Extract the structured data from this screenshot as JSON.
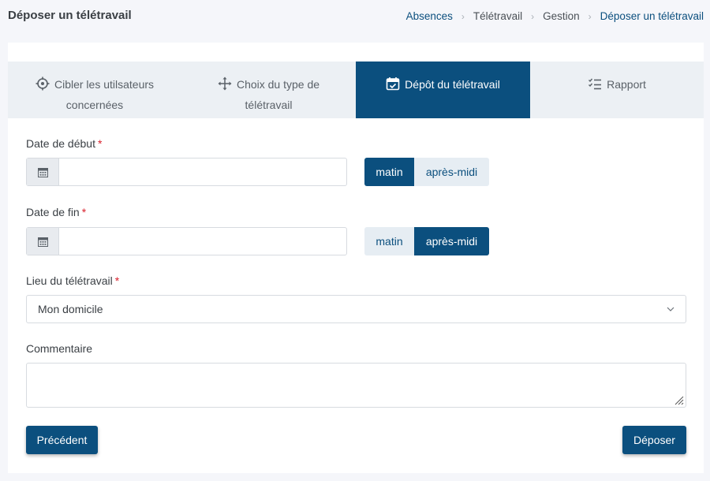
{
  "header": {
    "title": "Déposer un télétravail",
    "breadcrumb": [
      "Absences",
      "Télétravail",
      "Gestion",
      "Déposer un télétravail"
    ]
  },
  "tabs": [
    {
      "line1": "Cibler les utilsateurs",
      "line2": "concernées",
      "icon": "crosshair-icon"
    },
    {
      "line1": "Choix du type de",
      "line2": "télétravail",
      "icon": "move-arrows-icon"
    },
    {
      "line1": "Dépôt du télétravail",
      "line2": "",
      "icon": "calendar-check-icon",
      "active": true
    },
    {
      "line1": "Rapport",
      "line2": "",
      "icon": "checklist-icon"
    }
  ],
  "form": {
    "start": {
      "label": "Date de début",
      "required_mark": "*",
      "value": "",
      "half_options": [
        "matin",
        "après-midi"
      ],
      "selected": "matin"
    },
    "end": {
      "label": "Date de fin",
      "required_mark": "*",
      "value": "",
      "half_options": [
        "matin",
        "après-midi"
      ],
      "selected": "après-midi"
    },
    "place": {
      "label": "Lieu du télétravail",
      "required_mark": "*",
      "value": "Mon domicile"
    },
    "comment": {
      "label": "Commentaire",
      "value": ""
    }
  },
  "buttons": {
    "previous": "Précédent",
    "submit": "Déposer"
  },
  "colors": {
    "primary": "#0b4f7e",
    "required": "#d9202c",
    "tab_bar": "#ecf0f4",
    "segment_inactive": "#e6edf3"
  }
}
